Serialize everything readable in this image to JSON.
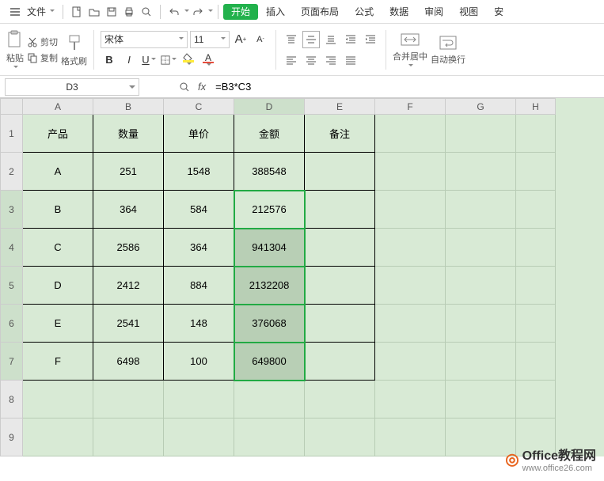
{
  "menubar": {
    "file_label": "文件",
    "tabs": [
      "开始",
      "插入",
      "页面布局",
      "公式",
      "数据",
      "审阅",
      "视图",
      "安"
    ]
  },
  "ribbon": {
    "paste_label": "粘贴",
    "cut_label": "剪切",
    "copy_label": "复制",
    "format_painter_label": "格式刷",
    "font_name": "宋体",
    "font_size": "11",
    "merge_label": "合并居中",
    "wrap_label": "自动换行"
  },
  "formula_bar": {
    "cell_ref": "D3",
    "formula": "=B3*C3"
  },
  "columns": [
    "A",
    "B",
    "C",
    "D",
    "E",
    "F",
    "G",
    "H"
  ],
  "rows": [
    "1",
    "2",
    "3",
    "4",
    "5",
    "6",
    "7",
    "8",
    "9"
  ],
  "table": {
    "headers": [
      "产品",
      "数量",
      "单价",
      "金额",
      "备注"
    ],
    "data": [
      [
        "A",
        "251",
        "1548",
        "388548",
        ""
      ],
      [
        "B",
        "364",
        "584",
        "212576",
        ""
      ],
      [
        "C",
        "2586",
        "364",
        "941304",
        ""
      ],
      [
        "D",
        "2412",
        "884",
        "2132208",
        ""
      ],
      [
        "E",
        "2541",
        "148",
        "376068",
        ""
      ],
      [
        "F",
        "6498",
        "100",
        "649800",
        ""
      ]
    ]
  },
  "watermark": {
    "brand": "Office教程网",
    "url": "www.office26.com"
  }
}
